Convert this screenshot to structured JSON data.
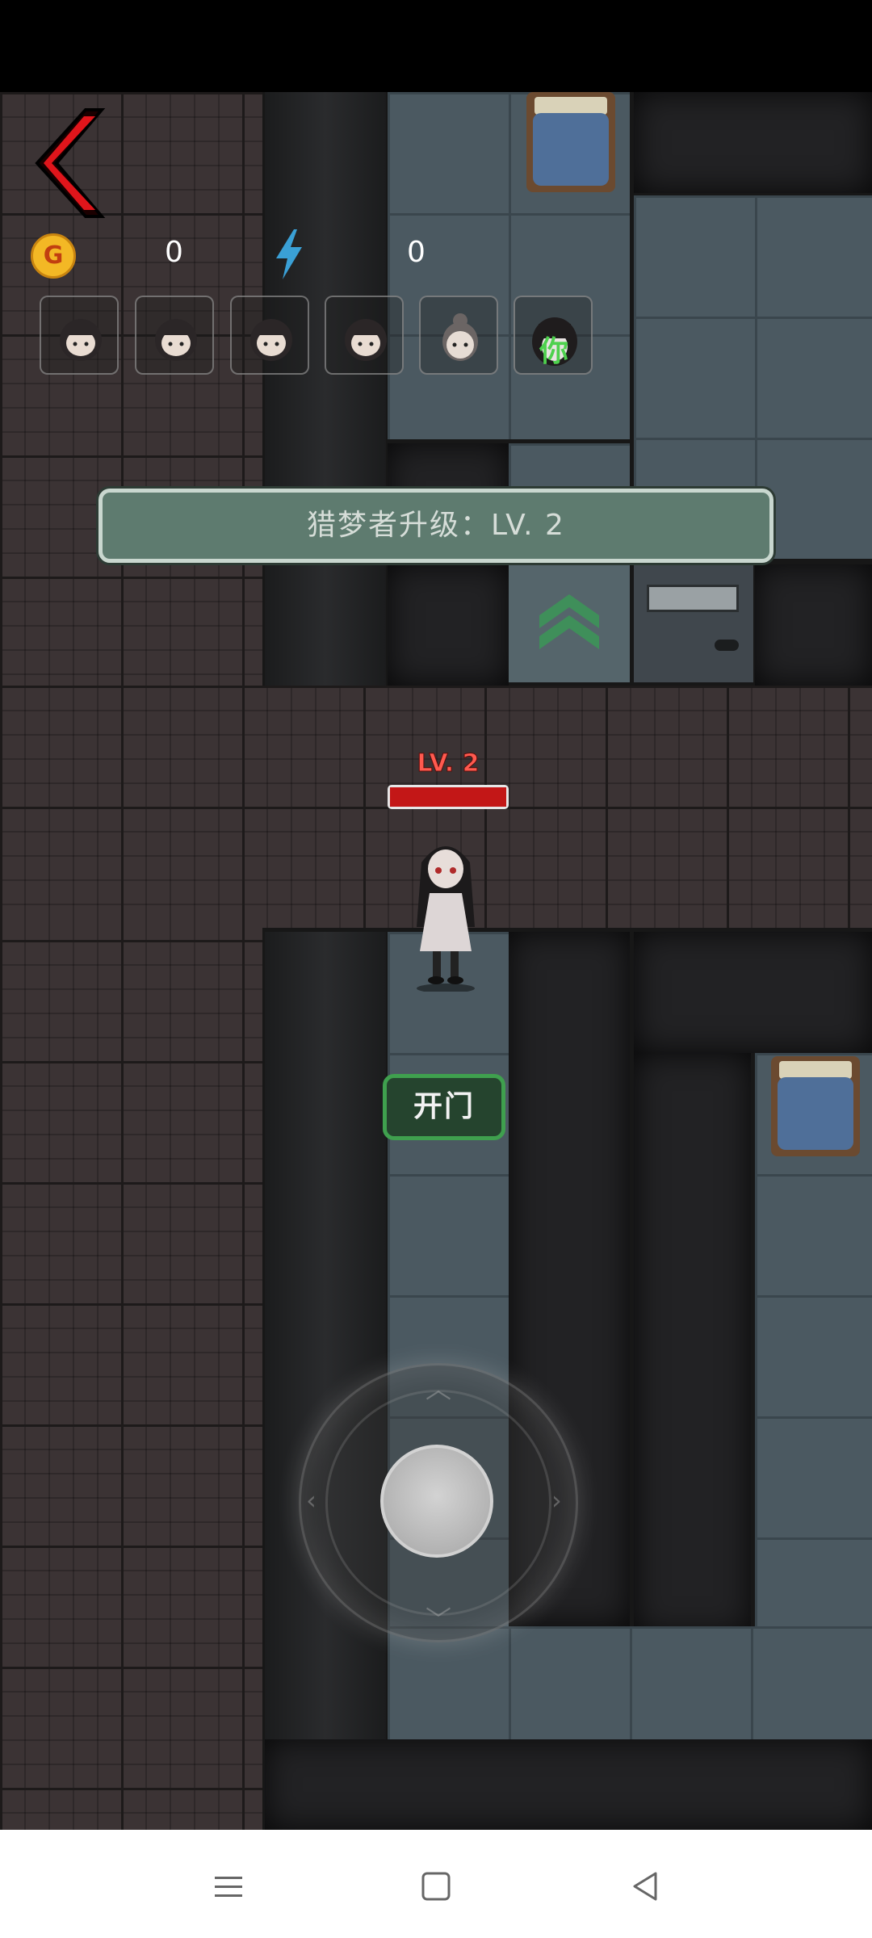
{
  "hud": {
    "coin_label": "G",
    "coins": "0",
    "energy": "0",
    "player_icons": [
      "girl-avatar",
      "girl-avatar",
      "girl-avatar",
      "girl-avatar",
      "old-woman-avatar",
      "ghost-avatar"
    ],
    "you_marker": "你"
  },
  "banner": {
    "text": "猎梦者升级：LV. 2"
  },
  "hunter": {
    "level_label": "LV. 2",
    "health_fraction": 1.0
  },
  "actions": {
    "open_door_label": "开门"
  },
  "colors": {
    "accent_red": "#e0151b",
    "banner_green": "#5e7b6f",
    "open_door_green": "#3fa04e",
    "level_red": "#ff5a4f"
  },
  "navbar": {
    "buttons": [
      "menu-icon",
      "home-icon",
      "back-icon"
    ]
  }
}
